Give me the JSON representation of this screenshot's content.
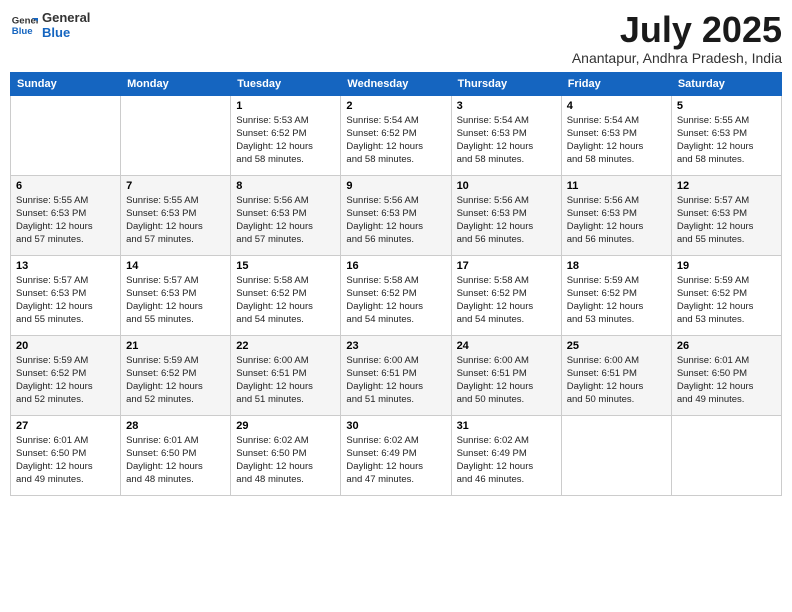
{
  "logo": {
    "line1": "General",
    "line2": "Blue"
  },
  "title": "July 2025",
  "subtitle": "Anantapur, Andhra Pradesh, India",
  "weekdays": [
    "Sunday",
    "Monday",
    "Tuesday",
    "Wednesday",
    "Thursday",
    "Friday",
    "Saturday"
  ],
  "weeks": [
    [
      {
        "day": "",
        "info": ""
      },
      {
        "day": "",
        "info": ""
      },
      {
        "day": "1",
        "info": "Sunrise: 5:53 AM\nSunset: 6:52 PM\nDaylight: 12 hours\nand 58 minutes."
      },
      {
        "day": "2",
        "info": "Sunrise: 5:54 AM\nSunset: 6:52 PM\nDaylight: 12 hours\nand 58 minutes."
      },
      {
        "day": "3",
        "info": "Sunrise: 5:54 AM\nSunset: 6:53 PM\nDaylight: 12 hours\nand 58 minutes."
      },
      {
        "day": "4",
        "info": "Sunrise: 5:54 AM\nSunset: 6:53 PM\nDaylight: 12 hours\nand 58 minutes."
      },
      {
        "day": "5",
        "info": "Sunrise: 5:55 AM\nSunset: 6:53 PM\nDaylight: 12 hours\nand 58 minutes."
      }
    ],
    [
      {
        "day": "6",
        "info": "Sunrise: 5:55 AM\nSunset: 6:53 PM\nDaylight: 12 hours\nand 57 minutes."
      },
      {
        "day": "7",
        "info": "Sunrise: 5:55 AM\nSunset: 6:53 PM\nDaylight: 12 hours\nand 57 minutes."
      },
      {
        "day": "8",
        "info": "Sunrise: 5:56 AM\nSunset: 6:53 PM\nDaylight: 12 hours\nand 57 minutes."
      },
      {
        "day": "9",
        "info": "Sunrise: 5:56 AM\nSunset: 6:53 PM\nDaylight: 12 hours\nand 56 minutes."
      },
      {
        "day": "10",
        "info": "Sunrise: 5:56 AM\nSunset: 6:53 PM\nDaylight: 12 hours\nand 56 minutes."
      },
      {
        "day": "11",
        "info": "Sunrise: 5:56 AM\nSunset: 6:53 PM\nDaylight: 12 hours\nand 56 minutes."
      },
      {
        "day": "12",
        "info": "Sunrise: 5:57 AM\nSunset: 6:53 PM\nDaylight: 12 hours\nand 55 minutes."
      }
    ],
    [
      {
        "day": "13",
        "info": "Sunrise: 5:57 AM\nSunset: 6:53 PM\nDaylight: 12 hours\nand 55 minutes."
      },
      {
        "day": "14",
        "info": "Sunrise: 5:57 AM\nSunset: 6:53 PM\nDaylight: 12 hours\nand 55 minutes."
      },
      {
        "day": "15",
        "info": "Sunrise: 5:58 AM\nSunset: 6:52 PM\nDaylight: 12 hours\nand 54 minutes."
      },
      {
        "day": "16",
        "info": "Sunrise: 5:58 AM\nSunset: 6:52 PM\nDaylight: 12 hours\nand 54 minutes."
      },
      {
        "day": "17",
        "info": "Sunrise: 5:58 AM\nSunset: 6:52 PM\nDaylight: 12 hours\nand 54 minutes."
      },
      {
        "day": "18",
        "info": "Sunrise: 5:59 AM\nSunset: 6:52 PM\nDaylight: 12 hours\nand 53 minutes."
      },
      {
        "day": "19",
        "info": "Sunrise: 5:59 AM\nSunset: 6:52 PM\nDaylight: 12 hours\nand 53 minutes."
      }
    ],
    [
      {
        "day": "20",
        "info": "Sunrise: 5:59 AM\nSunset: 6:52 PM\nDaylight: 12 hours\nand 52 minutes."
      },
      {
        "day": "21",
        "info": "Sunrise: 5:59 AM\nSunset: 6:52 PM\nDaylight: 12 hours\nand 52 minutes."
      },
      {
        "day": "22",
        "info": "Sunrise: 6:00 AM\nSunset: 6:51 PM\nDaylight: 12 hours\nand 51 minutes."
      },
      {
        "day": "23",
        "info": "Sunrise: 6:00 AM\nSunset: 6:51 PM\nDaylight: 12 hours\nand 51 minutes."
      },
      {
        "day": "24",
        "info": "Sunrise: 6:00 AM\nSunset: 6:51 PM\nDaylight: 12 hours\nand 50 minutes."
      },
      {
        "day": "25",
        "info": "Sunrise: 6:00 AM\nSunset: 6:51 PM\nDaylight: 12 hours\nand 50 minutes."
      },
      {
        "day": "26",
        "info": "Sunrise: 6:01 AM\nSunset: 6:50 PM\nDaylight: 12 hours\nand 49 minutes."
      }
    ],
    [
      {
        "day": "27",
        "info": "Sunrise: 6:01 AM\nSunset: 6:50 PM\nDaylight: 12 hours\nand 49 minutes."
      },
      {
        "day": "28",
        "info": "Sunrise: 6:01 AM\nSunset: 6:50 PM\nDaylight: 12 hours\nand 48 minutes."
      },
      {
        "day": "29",
        "info": "Sunrise: 6:02 AM\nSunset: 6:50 PM\nDaylight: 12 hours\nand 48 minutes."
      },
      {
        "day": "30",
        "info": "Sunrise: 6:02 AM\nSunset: 6:49 PM\nDaylight: 12 hours\nand 47 minutes."
      },
      {
        "day": "31",
        "info": "Sunrise: 6:02 AM\nSunset: 6:49 PM\nDaylight: 12 hours\nand 46 minutes."
      },
      {
        "day": "",
        "info": ""
      },
      {
        "day": "",
        "info": ""
      }
    ]
  ]
}
